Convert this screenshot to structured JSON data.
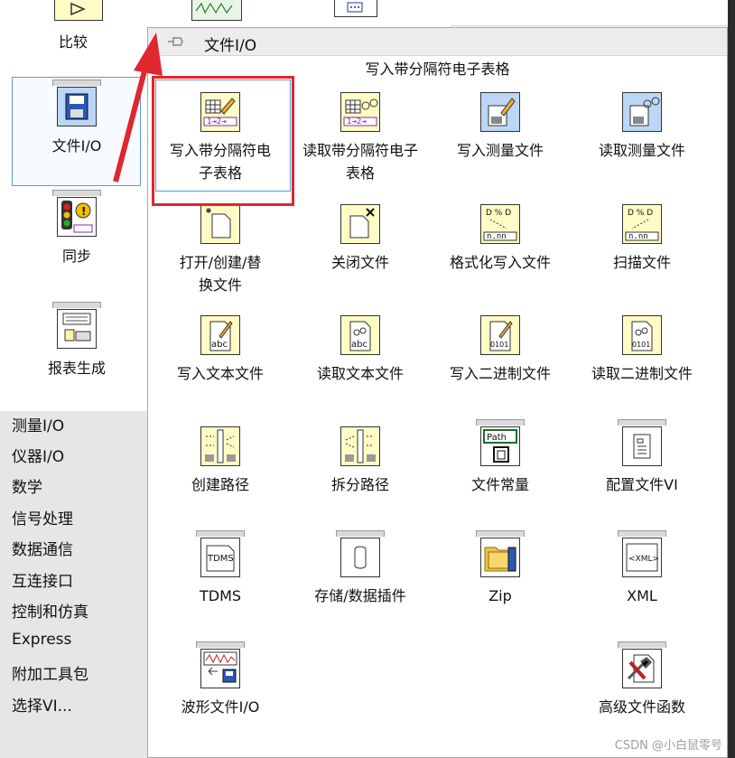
{
  "left_palette": {
    "top_tile_label": "比较",
    "tiles": [
      {
        "label": "文件I/O",
        "icon": "file-io-icon"
      },
      {
        "label": "同步",
        "icon": "sync-icon"
      },
      {
        "label": "报表生成",
        "icon": "report-icon"
      }
    ],
    "categories": [
      "测量I/O",
      "仪器I/O",
      "数学",
      "信号处理",
      "数据通信",
      "互连接口",
      "控制和仿真",
      "Express",
      "附加工具包",
      "选择VI..."
    ]
  },
  "submenu": {
    "title": "文件I/O",
    "hover_caption": "写入带分隔符电子表格",
    "tiles": [
      {
        "label": "写入带分隔符电子表格",
        "icon": "write-spreadsheet-icon"
      },
      {
        "label": "读取带分隔符电子表格",
        "icon": "read-spreadsheet-icon"
      },
      {
        "label": "写入测量文件",
        "icon": "write-measurement-icon"
      },
      {
        "label": "读取测量文件",
        "icon": "read-measurement-icon"
      },
      {
        "label": "打开/创建/替换文件",
        "icon": "open-create-replace-icon"
      },
      {
        "label": "关闭文件",
        "icon": "close-file-icon"
      },
      {
        "label": "格式化写入文件",
        "icon": "format-into-file-icon"
      },
      {
        "label": "扫描文件",
        "icon": "scan-file-icon"
      },
      {
        "label": "写入文本文件",
        "icon": "write-text-icon"
      },
      {
        "label": "读取文本文件",
        "icon": "read-text-icon"
      },
      {
        "label": "写入二进制文件",
        "icon": "write-binary-icon"
      },
      {
        "label": "读取二进制文件",
        "icon": "read-binary-icon"
      },
      {
        "label": "创建路径",
        "icon": "build-path-icon"
      },
      {
        "label": "拆分路径",
        "icon": "strip-path-icon"
      },
      {
        "label": "文件常量",
        "icon": "file-constants-icon"
      },
      {
        "label": "配置文件VI",
        "icon": "config-file-icon"
      },
      {
        "label": "TDMS",
        "icon": "tdms-icon"
      },
      {
        "label": "存储/数据插件",
        "icon": "storage-plugin-icon"
      },
      {
        "label": "Zip",
        "icon": "zip-icon"
      },
      {
        "label": "XML",
        "icon": "xml-icon"
      },
      {
        "label": "波形文件I/O",
        "icon": "waveform-file-icon"
      },
      {
        "label": "高级文件函数",
        "icon": "advanced-file-icon"
      }
    ]
  },
  "icon_text": {
    "tdms": "TDMS",
    "xml": "<XML>",
    "path": "Path",
    "abc": "abc",
    "bin": "0101",
    "nnn": "n.nn"
  },
  "watermark": "CSDN @小白鼠零号",
  "colors": {
    "highlight_border": "#e0262e",
    "selection_border": "#5b9bd5",
    "icon_yellow": "#fffbc4",
    "icon_blue": "#bcd7f6",
    "arrow": "#e0262e"
  }
}
